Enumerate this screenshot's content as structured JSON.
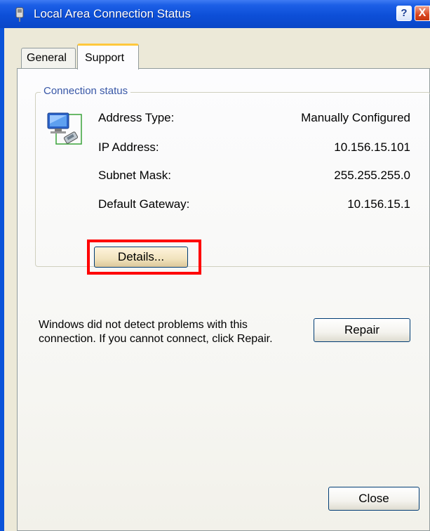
{
  "window": {
    "title": "Local Area Connection Status",
    "help_label": "?",
    "close_label": "X"
  },
  "tabs": [
    {
      "label": "General",
      "selected": false
    },
    {
      "label": "Support",
      "selected": true
    }
  ],
  "connection_status": {
    "group_label": "Connection status",
    "rows": [
      {
        "label": "Address Type:",
        "value": "Manually Configured"
      },
      {
        "label": "IP Address:",
        "value": "10.156.15.101"
      },
      {
        "label": "Subnet Mask:",
        "value": "255.255.255.0"
      },
      {
        "label": "Default Gateway:",
        "value": "10.156.15.1"
      }
    ],
    "details_button": "Details..."
  },
  "message": "Windows did not detect problems with this connection. If you cannot connect, click Repair.",
  "repair_button": "Repair",
  "close_button": "Close",
  "colors": {
    "title_bar": "#0a47c7",
    "highlight": "#ff0000",
    "tab_accent": "#ffc83c"
  }
}
